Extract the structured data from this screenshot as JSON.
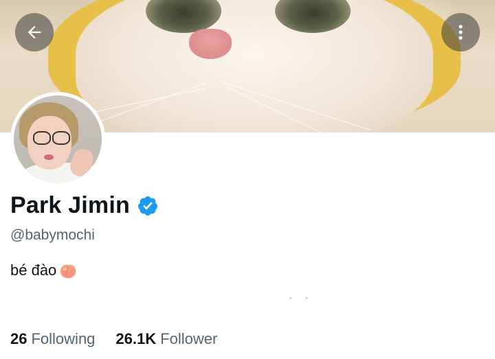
{
  "header": {
    "back_icon": "arrow-left-icon",
    "more_icon": "vertical-ellipsis-icon"
  },
  "profile": {
    "display_name": "Park Jimin",
    "verified": true,
    "verified_color": "#1d9bf0",
    "handle": "@babymochi",
    "bio_text": "bé đào",
    "bio_emoji": "peach"
  },
  "stats": {
    "following_count": "26",
    "following_label": "Following",
    "follower_count": "26.1K",
    "follower_label": "Follower"
  },
  "colors": {
    "text_primary": "#0f1419",
    "text_secondary": "#536471",
    "accent": "#1d9bf0"
  }
}
